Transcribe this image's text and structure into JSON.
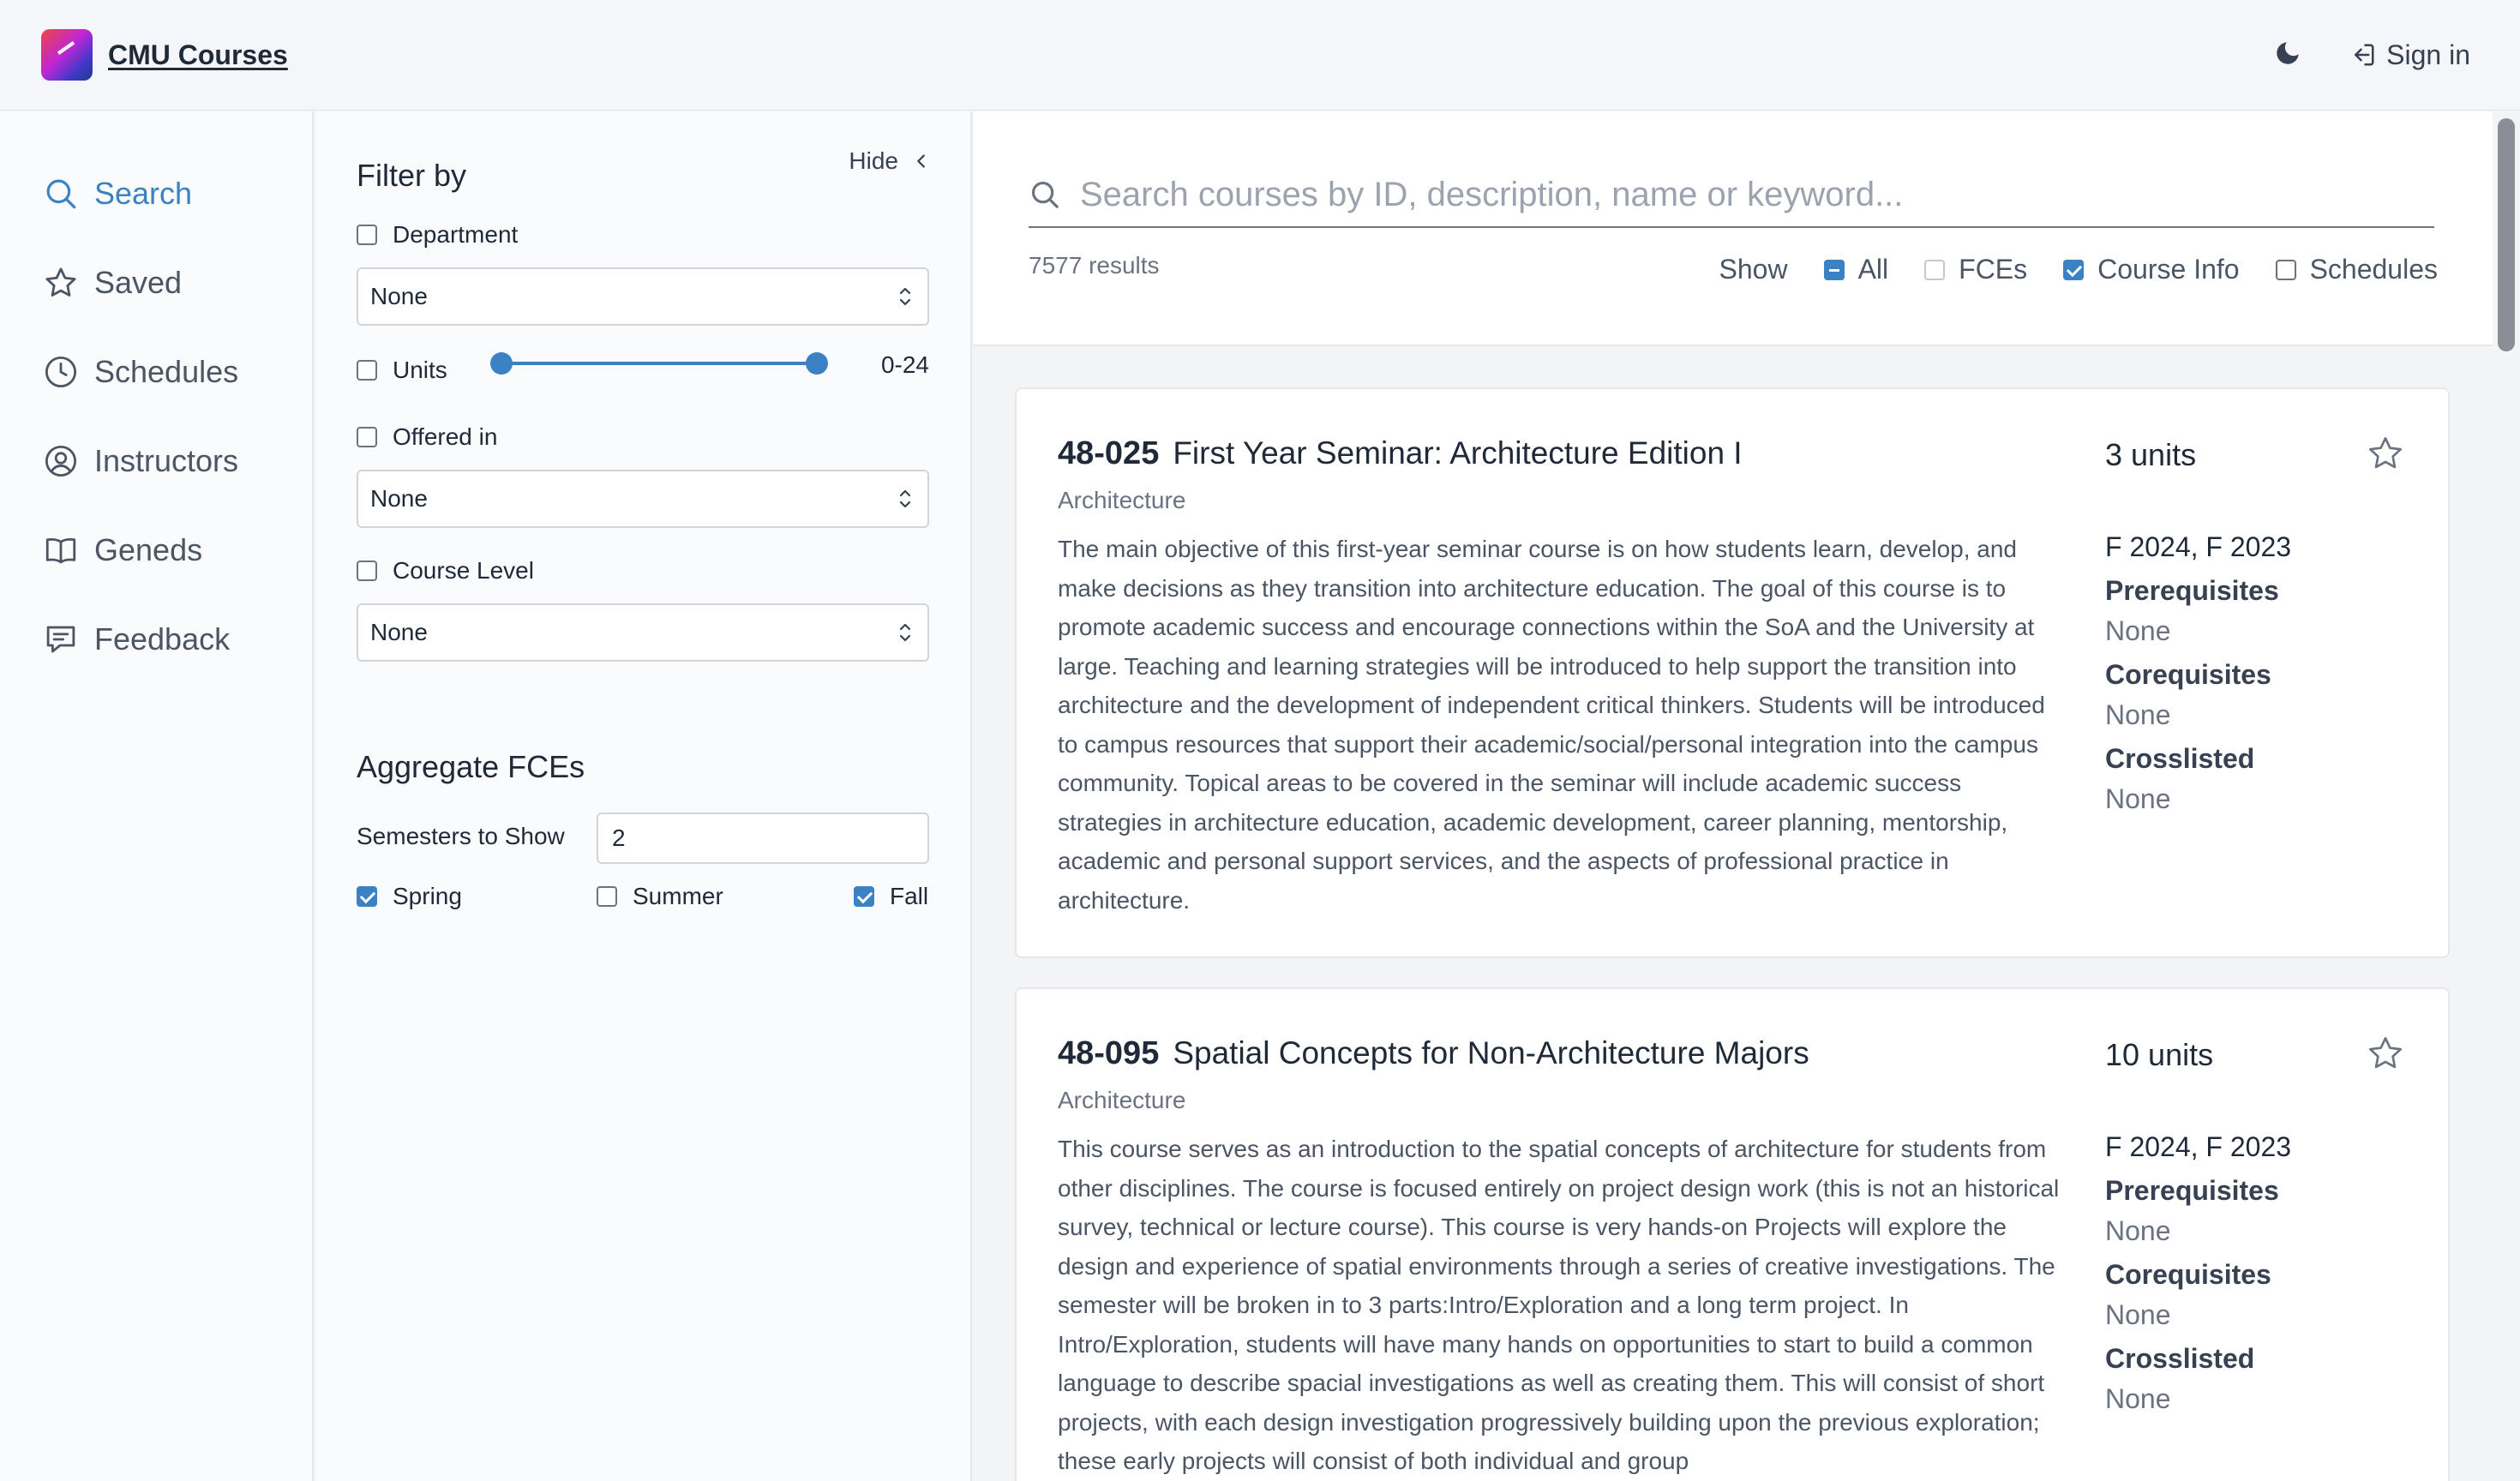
{
  "header": {
    "brand": "CMU Courses",
    "signin": "Sign in"
  },
  "nav": {
    "items": [
      {
        "label": "Search",
        "icon": "search-icon",
        "active": true
      },
      {
        "label": "Saved",
        "icon": "star-icon"
      },
      {
        "label": "Schedules",
        "icon": "clock-icon"
      },
      {
        "label": "Instructors",
        "icon": "user-circle-icon"
      },
      {
        "label": "Geneds",
        "icon": "book-icon"
      },
      {
        "label": "Feedback",
        "icon": "message-icon"
      }
    ]
  },
  "filter": {
    "title": "Filter by",
    "hide": "Hide",
    "department": {
      "label": "Department",
      "value": "None"
    },
    "units": {
      "label": "Units",
      "range": "0-24"
    },
    "offered": {
      "label": "Offered in",
      "value": "None"
    },
    "level": {
      "label": "Course Level",
      "value": "None"
    },
    "aggregate": {
      "title": "Aggregate FCEs",
      "semesters_label": "Semesters to Show",
      "semesters_value": "2",
      "spring": "Spring",
      "summer": "Summer",
      "fall": "Fall"
    }
  },
  "search": {
    "placeholder": "Search courses by ID, description, name or keyword...",
    "results": "7577 results",
    "show": "Show",
    "all": "All",
    "fces": "FCEs",
    "course_info": "Course Info",
    "schedules": "Schedules"
  },
  "courses": [
    {
      "id": "48-025",
      "name": "First Year Seminar: Architecture Edition I",
      "department": "Architecture",
      "units": "3 units",
      "semesters": "F 2024, F 2023",
      "prereq_label": "Prerequisites",
      "prereq": "None",
      "coreq_label": "Corequisites",
      "coreq": "None",
      "cross_label": "Crosslisted",
      "cross": "None",
      "description": "The main objective of this first-year seminar course is on how students learn, develop, and make decisions as they transition into architecture education. The goal of this course is to promote academic success and encourage connections within the SoA and the University at large. Teaching and learning strategies will be introduced to help support the transition into architecture and the development of independent critical thinkers. Students will be introduced to campus resources that support their academic/social/personal integration into the campus community. Topical areas to be covered in the seminar will include academic success strategies in architecture education, academic development, career planning, mentorship, academic and personal support services, and the aspects of professional practice in architecture."
    },
    {
      "id": "48-095",
      "name": "Spatial Concepts for Non-Architecture Majors",
      "department": "Architecture",
      "units": "10 units",
      "semesters": "F 2024, F 2023",
      "prereq_label": "Prerequisites",
      "prereq": "None",
      "coreq_label": "Corequisites",
      "coreq": "None",
      "cross_label": "Crosslisted",
      "cross": "None",
      "description": "This course serves as an introduction to the spatial concepts of architecture for students from other disciplines. The course is focused entirely on project design work (this is not an historical survey, technical or lecture course). This course is very hands-on Projects will explore the design and experience of spatial environments through a series of creative investigations. The semester will be broken in to 3 parts:Intro/Exploration and a long term project. In Intro/Exploration, students will have many hands on opportunities to start to build a common language to describe spacial investigations as well as creating them. This will consist of short projects, with each design investigation progressively building upon the previous exploration; these early projects will consist of both individual and group"
    }
  ]
}
